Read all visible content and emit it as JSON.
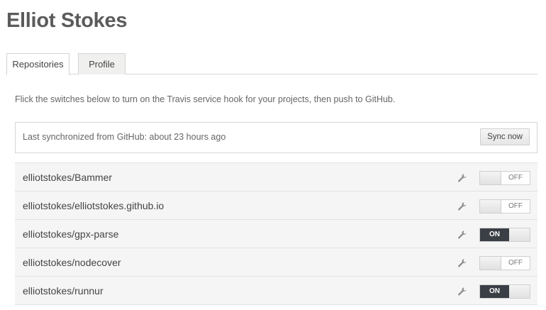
{
  "header": {
    "title": "Elliot Stokes"
  },
  "tabs": [
    {
      "label": "Repositories",
      "active": true
    },
    {
      "label": "Profile",
      "active": false
    }
  ],
  "intro_text": "Flick the switches below to turn on the Travis service hook for your projects, then push to GitHub.",
  "sync": {
    "status_text": "Last synchronized from GitHub: about 23 hours ago",
    "button_label": "Sync now"
  },
  "repositories": [
    {
      "name": "elliotstokes/Bammer",
      "hook_state": "OFF"
    },
    {
      "name": "elliotstokes/elliotstokes.github.io",
      "hook_state": "OFF"
    },
    {
      "name": "elliotstokes/gpx-parse",
      "hook_state": "ON"
    },
    {
      "name": "elliotstokes/nodecover",
      "hook_state": "OFF"
    },
    {
      "name": "elliotstokes/runnur",
      "hook_state": "ON"
    }
  ],
  "icons": {
    "settings": "wrench-icon"
  },
  "colors": {
    "toggle_on_bg": "#3a3f45",
    "row_bg": "#f5f5f5"
  }
}
